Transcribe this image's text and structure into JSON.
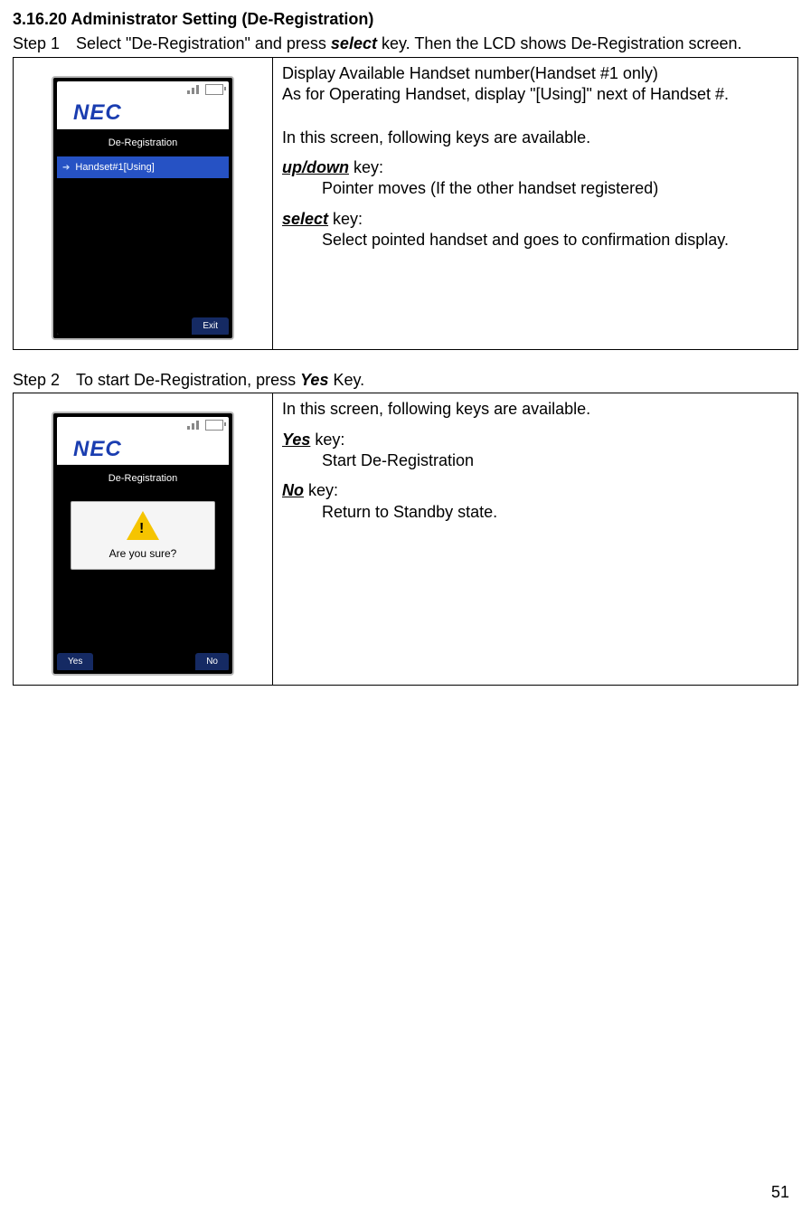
{
  "heading": "3.16.20   Administrator Setting (De-Registration)",
  "step1": {
    "label": "Step 1",
    "text_1": "Select \"De-Registration\" and press ",
    "text_select": "select",
    "text_2": " key. Then the LCD shows De-Registration screen."
  },
  "box1": {
    "line1": "Display Available Handset number(Handset #1 only)",
    "line2": "As for Operating Handset, display \"[Using]\" next of Handset #.",
    "line3": "In this screen, following keys are available.",
    "updown": "up/down",
    "updown_key": " key:",
    "updown_desc": "Pointer moves (If the other handset registered)",
    "select": "select",
    "select_key": " key:",
    "select_desc": "Select pointed handset and goes to confirmation display."
  },
  "step2": {
    "label": "Step 2",
    "text_1": "To start De-Registration, press ",
    "text_yes": "Yes",
    "text_2": " Key."
  },
  "box2": {
    "line1": "In this screen, following keys are available.",
    "yes": "Yes",
    "yes_key": " key:",
    "yes_desc": "Start De-Registration",
    "no": "No",
    "no_key": " key:",
    "no_desc": "Return to Standby state."
  },
  "phone": {
    "brand": "NEC",
    "title": "De-Registration",
    "row": "Handset#1[Using]",
    "exit": "Exit",
    "yes": "Yes",
    "no": "No",
    "popup": "Are you sure?"
  },
  "page_num": "51"
}
